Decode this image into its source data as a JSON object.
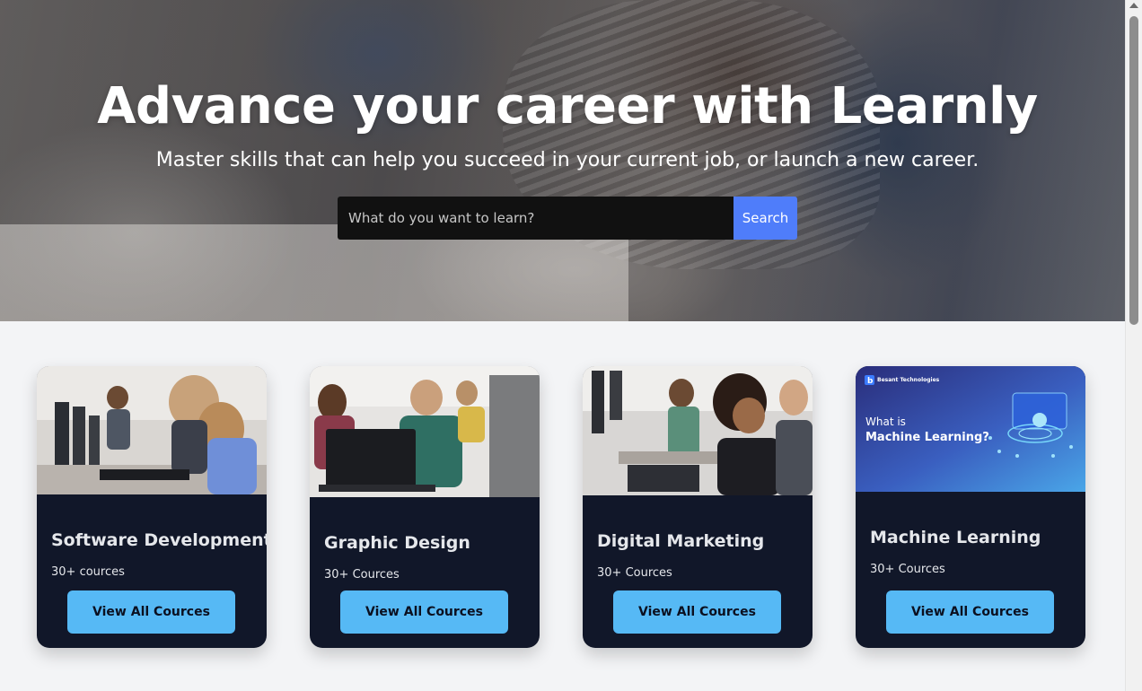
{
  "hero": {
    "title": "Advance your career with Learnly",
    "subtitle": "Master skills that can help you succeed in your current job, or launch a new career.",
    "search_placeholder": "What do you want to learn?",
    "search_button": "Search"
  },
  "cards": [
    {
      "title": "Software Development",
      "count": "30+ cources",
      "button": "View All Cources"
    },
    {
      "title": "Graphic Design",
      "count": "30+ Cources",
      "button": "View All Cources"
    },
    {
      "title": "Digital Marketing",
      "count": "30+ Cources",
      "button": "View All Cources"
    },
    {
      "title": "Machine Learning",
      "count": "30+ Cources",
      "button": "View All Cources",
      "banner_brand": "Besant Technologies",
      "banner_line1": "What is",
      "banner_line2": "Machine Learning?"
    }
  ],
  "colors": {
    "card_bg": "#111729",
    "button": "#56b9f5",
    "search_button": "#4f7dfa"
  }
}
